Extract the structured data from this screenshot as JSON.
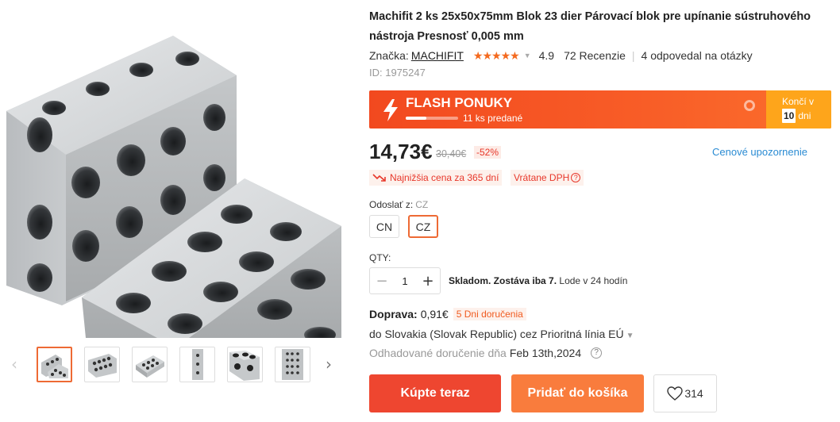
{
  "gallery": {
    "main_image_alt": "",
    "prev_label": "‹",
    "next_label": "›",
    "thumbnails": [
      "",
      "",
      "",
      "",
      "",
      ""
    ]
  },
  "product": {
    "title": "Machifit 2 ks 25x50x75mm Blok 23 dier Párovací blok pre upínanie sústruhového nástroja Presnosť 0,005 mm",
    "brand_label": "Značka:",
    "brand": "MACHIFIT",
    "stars": "★★★★★",
    "rating": "4.9",
    "reviews": "72 Recenzie",
    "questions": "4 odpovedal na otázky",
    "id": "ID: 1975247"
  },
  "flash": {
    "title": "FLASH PONUKY",
    "sold": "11 ks predané",
    "sold_progress": 0.4,
    "ends_label": "Končí v",
    "days_value": "10",
    "days_unit": "dni",
    "color_start": "#f2491f",
    "color_end": "#fb6e2d",
    "ends_bg": "#fea51b"
  },
  "pricing": {
    "price": "14,73€",
    "old_price": "30,40€",
    "discount": "-52%",
    "price_alert": "Cenové upozornenie",
    "lowest": "Najnižšia cena za 365 dní",
    "vat": "Vrátane DPH"
  },
  "options": {
    "ship_from_label": "Odoslať z:",
    "ship_from_value": "CZ",
    "choices": [
      "CN",
      "CZ"
    ],
    "selected": "CZ"
  },
  "quantity": {
    "label": "QTY:",
    "value": "1",
    "minus": "−",
    "plus": "+",
    "stock": "Skladom. Zostáva iba 7.",
    "ship_time": "Lode v 24 hodín"
  },
  "shipping": {
    "label": "Doprava:",
    "cost": "0,91€",
    "delivery_badge": "5 Dni doručenia",
    "route": "do Slovakia (Slovak Republic) cez Prioritná línia EÚ",
    "eta_label": "Odhadované doručenie dňa",
    "eta_date": "Feb 13th,2024"
  },
  "actions": {
    "buy_now": "Kúpte teraz",
    "add_to_cart": "Pridať do košíka",
    "wishlist_count": "314",
    "buy_color": "#ee4630",
    "cart_color": "#f97c3d"
  }
}
